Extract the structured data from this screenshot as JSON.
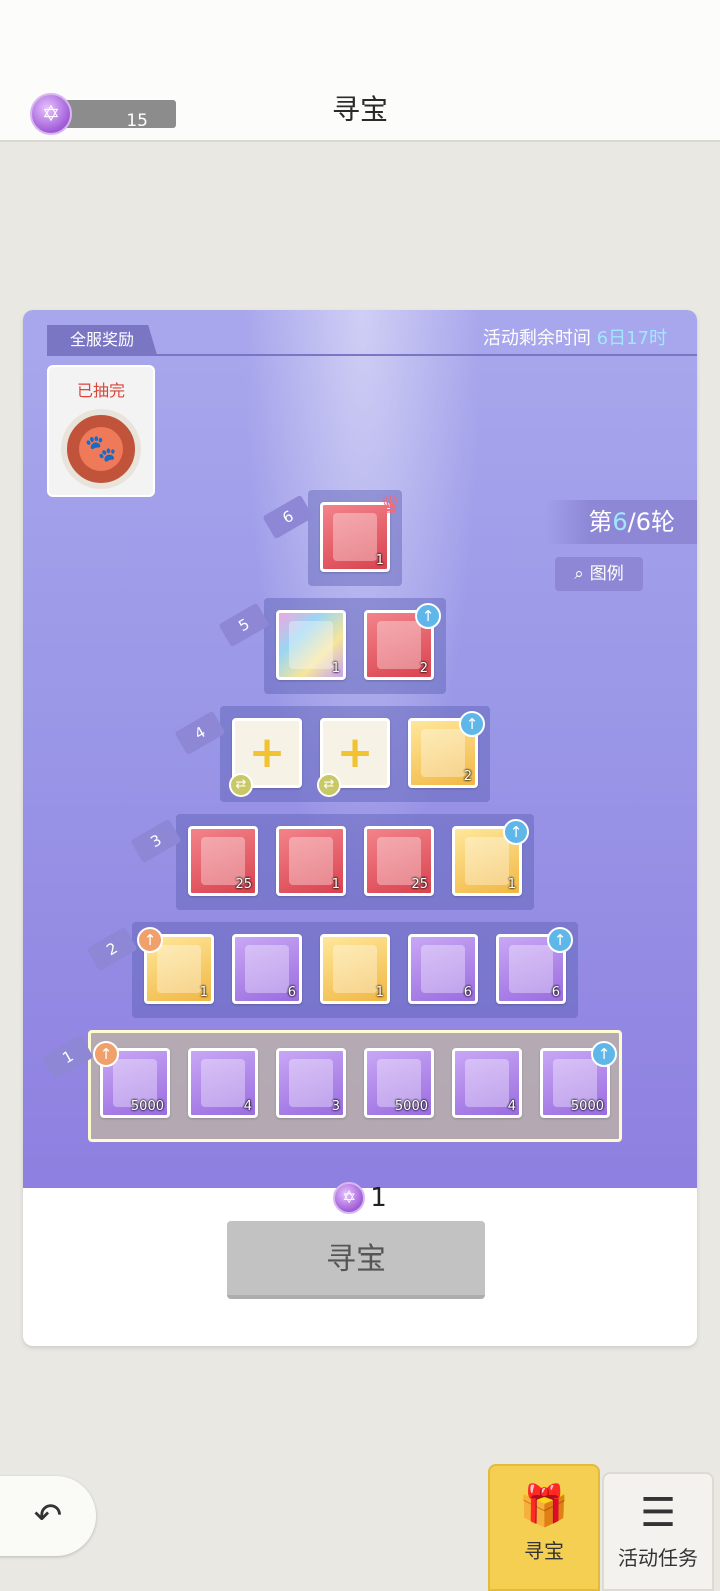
{
  "header": {
    "title": "寻宝",
    "currency_amount": "15"
  },
  "board": {
    "tag": "全服奖励",
    "timer_label": "活动剩余时间 ",
    "timer_value": "6日17时",
    "special": {
      "label": "已抽完"
    },
    "round_prefix": "第",
    "round_current": "6",
    "round_suffix": "/6轮",
    "legend_label": "图例",
    "rows": [
      {
        "label": "6",
        "items": [
          {
            "count": "1",
            "color": "red",
            "crown": true
          }
        ]
      },
      {
        "label": "5",
        "items": [
          {
            "count": "1",
            "color": "holo"
          },
          {
            "count": "2",
            "color": "red",
            "up": true
          }
        ]
      },
      {
        "label": "4",
        "items": [
          {
            "count": "",
            "color": "white",
            "plus": true
          },
          {
            "count": "",
            "color": "white",
            "plus": true
          },
          {
            "count": "2",
            "color": "gold",
            "up": true
          }
        ]
      },
      {
        "label": "3",
        "items": [
          {
            "count": "25",
            "color": "red"
          },
          {
            "count": "1",
            "color": "red"
          },
          {
            "count": "25",
            "color": "red"
          },
          {
            "count": "1",
            "color": "gold",
            "up": true
          }
        ]
      },
      {
        "label": "2",
        "items": [
          {
            "count": "1",
            "color": "gold",
            "upor": true
          },
          {
            "count": "6",
            "color": "pur"
          },
          {
            "count": "1",
            "color": "gold"
          },
          {
            "count": "6",
            "color": "pur"
          },
          {
            "count": "6",
            "color": "pur",
            "up": true
          }
        ]
      },
      {
        "label": "1",
        "items": [
          {
            "count": "5000",
            "color": "pur",
            "upor": true
          },
          {
            "count": "4",
            "color": "pur"
          },
          {
            "count": "3",
            "color": "pur"
          },
          {
            "count": "5000",
            "color": "pur"
          },
          {
            "count": "4",
            "color": "pur"
          },
          {
            "count": "5000",
            "color": "pur",
            "up": true
          }
        ]
      }
    ]
  },
  "cost": {
    "amount": "1"
  },
  "action_button": "寻宝",
  "bottom_tabs": [
    {
      "label": "寻宝",
      "active": true
    },
    {
      "label": "活动任务",
      "active": false
    }
  ]
}
